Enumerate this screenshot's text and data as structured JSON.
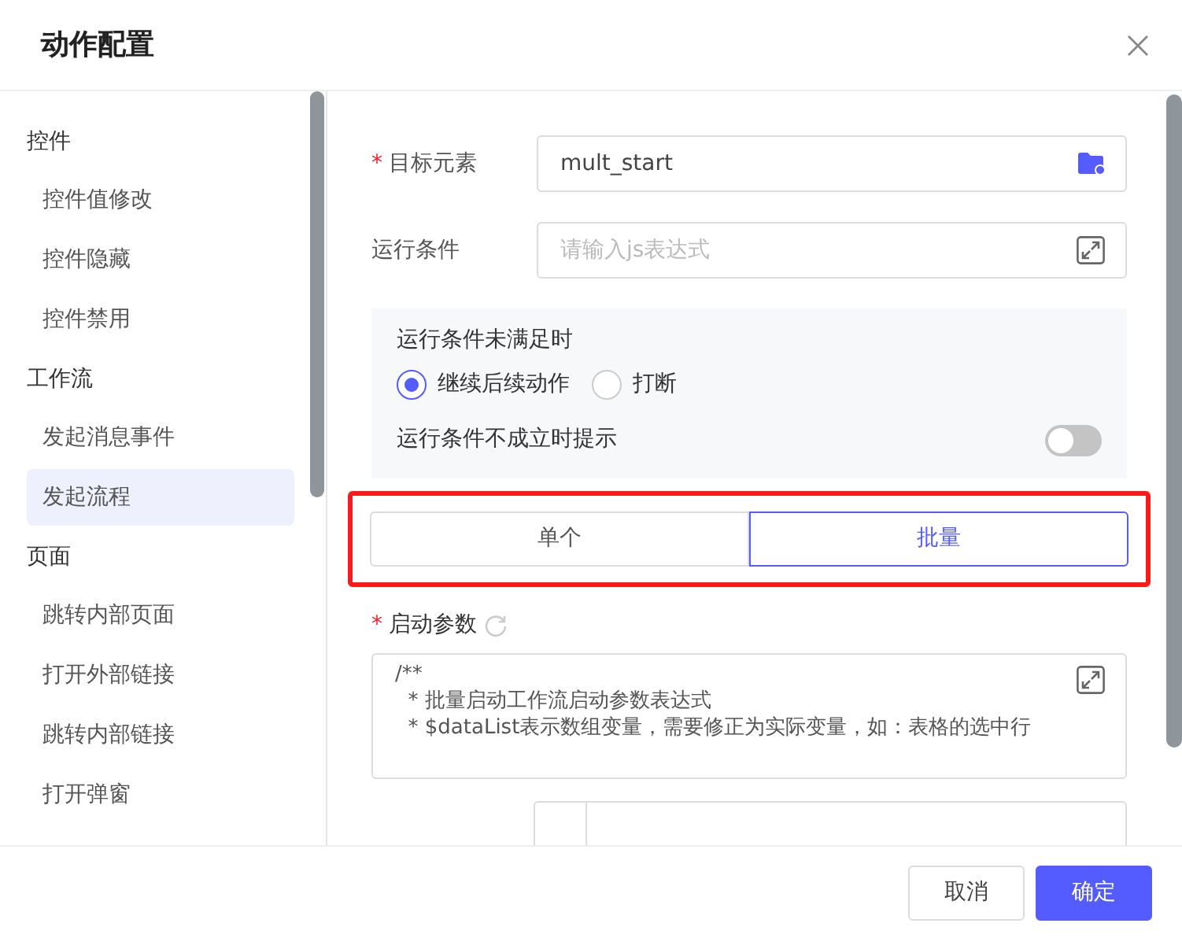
{
  "dialog": {
    "title": "动作配置"
  },
  "sidebar": {
    "groups": [
      {
        "label": "控件",
        "items": [
          {
            "label": "控件值修改",
            "selected": false
          },
          {
            "label": "控件隐藏",
            "selected": false
          },
          {
            "label": "控件禁用",
            "selected": false
          }
        ]
      },
      {
        "label": "工作流",
        "items": [
          {
            "label": "发起消息事件",
            "selected": false
          },
          {
            "label": "发起流程",
            "selected": true
          }
        ]
      },
      {
        "label": "页面",
        "items": [
          {
            "label": "跳转内部页面",
            "selected": false
          },
          {
            "label": "打开外部链接",
            "selected": false
          },
          {
            "label": "跳转内部链接",
            "selected": false
          },
          {
            "label": "打开弹窗",
            "selected": false
          }
        ]
      }
    ]
  },
  "form": {
    "target": {
      "label": "目标元素",
      "mark": "*",
      "value": "mult_start"
    },
    "condition": {
      "label": "运行条件",
      "placeholder": "请输入js表达式"
    },
    "unmet": {
      "label": "运行条件未满足时",
      "options": [
        {
          "label": "继续后续动作",
          "selected": true
        },
        {
          "label": "打断",
          "selected": false
        }
      ]
    },
    "prompt": {
      "label": "运行条件不成立时提示",
      "on": false
    },
    "mode": {
      "highlighted": true,
      "options": [
        {
          "label": "单个",
          "selected": false
        },
        {
          "label": "批量",
          "selected": true
        }
      ]
    },
    "params": {
      "label": "启动参数",
      "mark": "*",
      "code": "/**\n  * 批量启动工作流启动参数表达式\n  * $dataList表示数组变量，需要修正为实际变量，如：表格的选中行"
    }
  },
  "footer": {
    "buttons": [
      {
        "label": "取消",
        "kind": "secondary"
      },
      {
        "label": "确定",
        "kind": "primary"
      }
    ]
  }
}
